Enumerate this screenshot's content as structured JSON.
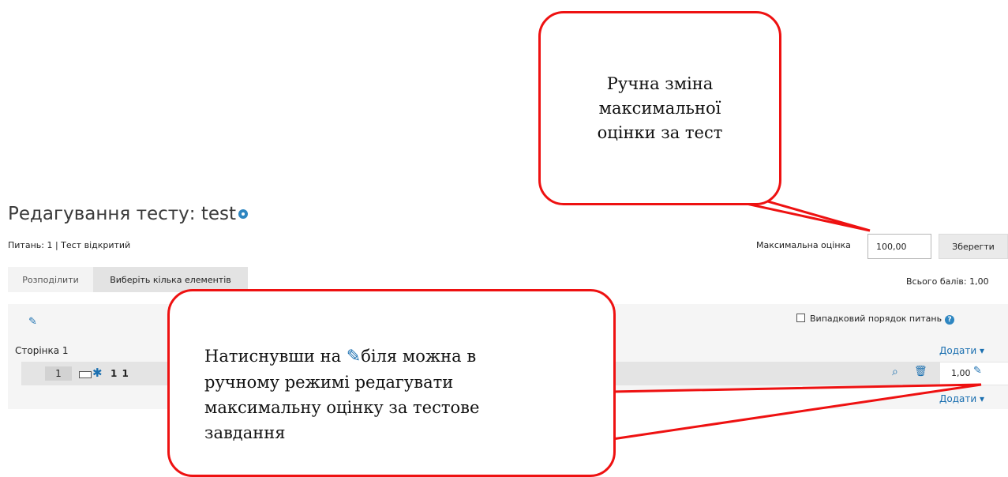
{
  "page": {
    "title": "Редагування тесту: test",
    "info": "Питань: 1 | Тест відкритий"
  },
  "max_grade": {
    "label": "Максимальна оцінка",
    "value": "100,00",
    "save_label": "Зберегти"
  },
  "toolbar": {
    "repaginate_label": "Розподілити",
    "select_multiple_label": "Виберіть кілька елементів",
    "total_marks": "Всього балів: 1,00"
  },
  "section": {
    "shuffle_label": "Випадковий порядок питань",
    "page_label": "Сторінка 1",
    "add_label": "Додати ▾"
  },
  "question": {
    "number": "1",
    "name": "1 1",
    "mark": "1,00"
  },
  "callouts": {
    "top_line1": "Ручна зміна",
    "top_line2": "максимальної",
    "top_line3": "оцінки за тест",
    "bottom_part1": "Натиснувши на",
    "bottom_part2": "біля можна в",
    "bottom_line2": "ручному режимі редагувати",
    "bottom_line3": "максимальну оцінку за тестове",
    "bottom_line4": "завдання"
  },
  "colors": {
    "callout_border": "#ee1111",
    "link": "#1a6fb0"
  },
  "icons": [
    "help-icon",
    "pencil-icon",
    "gear-icon",
    "preview-icon",
    "trash-icon",
    "checkbox-icon",
    "question-type-icon"
  ]
}
